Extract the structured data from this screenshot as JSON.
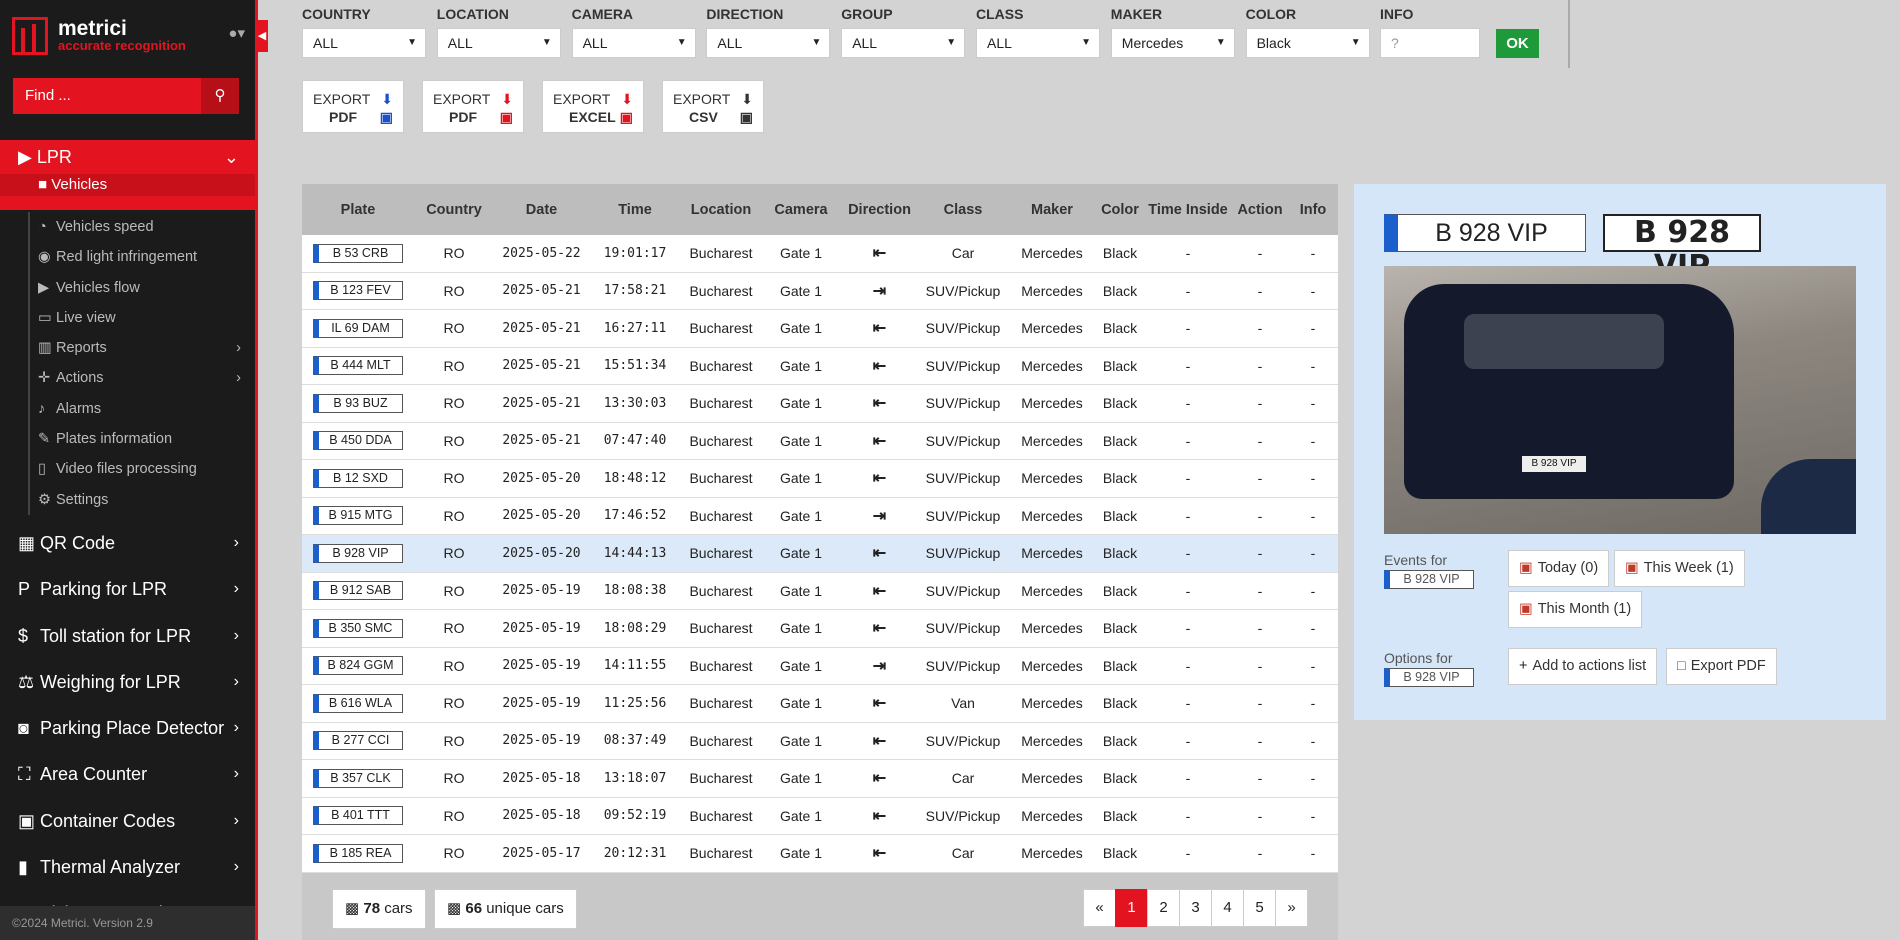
{
  "app": {
    "brand": "metrici",
    "tagline": "accurate recognition",
    "footer": "©2024 Metrici. Version 2.9"
  },
  "search": {
    "placeholder": "Find ..."
  },
  "sidebar": {
    "active_section": "LPR",
    "active_item": "Vehicles",
    "sub_items": [
      {
        "label": "Vehicles speed",
        "icon": "speedometer-icon",
        "chev": ""
      },
      {
        "label": "Red light infringement",
        "icon": "traffic-light-icon",
        "chev": ""
      },
      {
        "label": "Vehicles flow",
        "icon": "video-icon",
        "chev": ""
      },
      {
        "label": "Live view",
        "icon": "monitor-icon",
        "chev": ""
      },
      {
        "label": "Reports",
        "icon": "chart-icon",
        "chev": "›"
      },
      {
        "label": "Actions",
        "icon": "crosshair-icon",
        "chev": "›"
      },
      {
        "label": "Alarms",
        "icon": "bell-icon",
        "chev": ""
      },
      {
        "label": "Plates information",
        "icon": "edit-icon",
        "chev": ""
      },
      {
        "label": "Video files processing",
        "icon": "file-icon",
        "chev": ""
      },
      {
        "label": "Settings",
        "icon": "gear-icon",
        "chev": ""
      }
    ],
    "main_items": [
      {
        "label": "QR Code",
        "icon": "qr-icon"
      },
      {
        "label": "Parking for LPR",
        "icon": "parking-icon"
      },
      {
        "label": "Toll station for LPR",
        "icon": "dollar-icon"
      },
      {
        "label": "Weighing for LPR",
        "icon": "scale-icon"
      },
      {
        "label": "Parking Place Detector",
        "icon": "car-icon"
      },
      {
        "label": "Area Counter",
        "icon": "expand-icon"
      },
      {
        "label": "Container Codes",
        "icon": "boxes-icon"
      },
      {
        "label": "Thermal Analyzer",
        "icon": "thermometer-icon"
      },
      {
        "label": "Visitors Journal",
        "icon": "book-icon"
      }
    ]
  },
  "filters": [
    {
      "label": "COUNTRY",
      "value": "ALL"
    },
    {
      "label": "LOCATION",
      "value": "ALL"
    },
    {
      "label": "CAMERA",
      "value": "ALL"
    },
    {
      "label": "DIRECTION",
      "value": "ALL"
    },
    {
      "label": "GROUP",
      "value": "ALL"
    },
    {
      "label": "CLASS",
      "value": "ALL"
    },
    {
      "label": "MAKER",
      "value": "Mercedes"
    },
    {
      "label": "COLOR",
      "value": "Black"
    }
  ],
  "info": {
    "label": "INFO",
    "placeholder": "?"
  },
  "ok_label": "OK",
  "exports": [
    {
      "top": "EXPORT",
      "bottom": "PDF",
      "color": "#1b4fcc"
    },
    {
      "top": "EXPORT",
      "bottom": "PDF",
      "color": "#e3141f"
    },
    {
      "top": "EXPORT",
      "bottom": "EXCEL",
      "color": "#e3141f"
    },
    {
      "top": "EXPORT",
      "bottom": "CSV",
      "color": "#333333"
    }
  ],
  "table": {
    "headers": [
      "Plate",
      "Country",
      "Date",
      "Time",
      "Location",
      "Camera",
      "Direction",
      "Class",
      "Maker",
      "Color",
      "Time Inside",
      "Action",
      "Info"
    ],
    "rows": [
      [
        "B 53 CRB",
        "RO",
        "2025-05-22",
        "19:01:17",
        "Bucharest",
        "Gate 1",
        "in",
        "Car",
        "Mercedes",
        "Black",
        "-",
        "-",
        "-"
      ],
      [
        "B 123 FEV",
        "RO",
        "2025-05-21",
        "17:58:21",
        "Bucharest",
        "Gate 1",
        "out",
        "SUV/Pickup",
        "Mercedes",
        "Black",
        "-",
        "-",
        "-"
      ],
      [
        "IL 69 DAM",
        "RO",
        "2025-05-21",
        "16:27:11",
        "Bucharest",
        "Gate 1",
        "in",
        "SUV/Pickup",
        "Mercedes",
        "Black",
        "-",
        "-",
        "-"
      ],
      [
        "B 444 MLT",
        "RO",
        "2025-05-21",
        "15:51:34",
        "Bucharest",
        "Gate 1",
        "in",
        "SUV/Pickup",
        "Mercedes",
        "Black",
        "-",
        "-",
        "-"
      ],
      [
        "B 93 BUZ",
        "RO",
        "2025-05-21",
        "13:30:03",
        "Bucharest",
        "Gate 1",
        "in",
        "SUV/Pickup",
        "Mercedes",
        "Black",
        "-",
        "-",
        "-"
      ],
      [
        "B 450 DDA",
        "RO",
        "2025-05-21",
        "07:47:40",
        "Bucharest",
        "Gate 1",
        "in",
        "SUV/Pickup",
        "Mercedes",
        "Black",
        "-",
        "-",
        "-"
      ],
      [
        "B 12 SXD",
        "RO",
        "2025-05-20",
        "18:48:12",
        "Bucharest",
        "Gate 1",
        "in",
        "SUV/Pickup",
        "Mercedes",
        "Black",
        "-",
        "-",
        "-"
      ],
      [
        "B 915 MTG",
        "RO",
        "2025-05-20",
        "17:46:52",
        "Bucharest",
        "Gate 1",
        "out",
        "SUV/Pickup",
        "Mercedes",
        "Black",
        "-",
        "-",
        "-"
      ],
      [
        "B 928 VIP",
        "RO",
        "2025-05-20",
        "14:44:13",
        "Bucharest",
        "Gate 1",
        "in",
        "SUV/Pickup",
        "Mercedes",
        "Black",
        "-",
        "-",
        "-"
      ],
      [
        "B 912 SAB",
        "RO",
        "2025-05-19",
        "18:08:38",
        "Bucharest",
        "Gate 1",
        "in",
        "SUV/Pickup",
        "Mercedes",
        "Black",
        "-",
        "-",
        "-"
      ],
      [
        "B 350 SMC",
        "RO",
        "2025-05-19",
        "18:08:29",
        "Bucharest",
        "Gate 1",
        "in",
        "SUV/Pickup",
        "Mercedes",
        "Black",
        "-",
        "-",
        "-"
      ],
      [
        "B 824 GGM",
        "RO",
        "2025-05-19",
        "14:11:55",
        "Bucharest",
        "Gate 1",
        "out",
        "SUV/Pickup",
        "Mercedes",
        "Black",
        "-",
        "-",
        "-"
      ],
      [
        "B 616 WLA",
        "RO",
        "2025-05-19",
        "11:25:56",
        "Bucharest",
        "Gate 1",
        "in",
        "Van",
        "Mercedes",
        "Black",
        "-",
        "-",
        "-"
      ],
      [
        "B 277 CCI",
        "RO",
        "2025-05-19",
        "08:37:49",
        "Bucharest",
        "Gate 1",
        "in",
        "SUV/Pickup",
        "Mercedes",
        "Black",
        "-",
        "-",
        "-"
      ],
      [
        "B 357 CLK",
        "RO",
        "2025-05-18",
        "13:18:07",
        "Bucharest",
        "Gate 1",
        "in",
        "Car",
        "Mercedes",
        "Black",
        "-",
        "-",
        "-"
      ],
      [
        "B 401 TTT",
        "RO",
        "2025-05-18",
        "09:52:19",
        "Bucharest",
        "Gate 1",
        "in",
        "SUV/Pickup",
        "Mercedes",
        "Black",
        "-",
        "-",
        "-"
      ],
      [
        "B 185 REA",
        "RO",
        "2025-05-17",
        "20:12:31",
        "Bucharest",
        "Gate 1",
        "in",
        "Car",
        "Mercedes",
        "Black",
        "-",
        "-",
        "-"
      ]
    ],
    "selected_row": 8
  },
  "totals": {
    "cars": "78",
    "cars_label": "cars",
    "unique": "66",
    "unique_label": "unique cars"
  },
  "pager": {
    "pages": [
      "1",
      "2",
      "3",
      "4",
      "5"
    ],
    "active": "1",
    "first": "«",
    "last": "»"
  },
  "detail": {
    "plate": "B 928 VIP",
    "events_label": "Events for",
    "options_label": "Options for",
    "photo_plate": "B 928 VIP",
    "events": [
      {
        "label": "Today (0)"
      },
      {
        "label": "This Week (1)"
      },
      {
        "label": "This Month (1)"
      }
    ],
    "add_label": "Add to actions list",
    "export_label": "Export PDF"
  }
}
